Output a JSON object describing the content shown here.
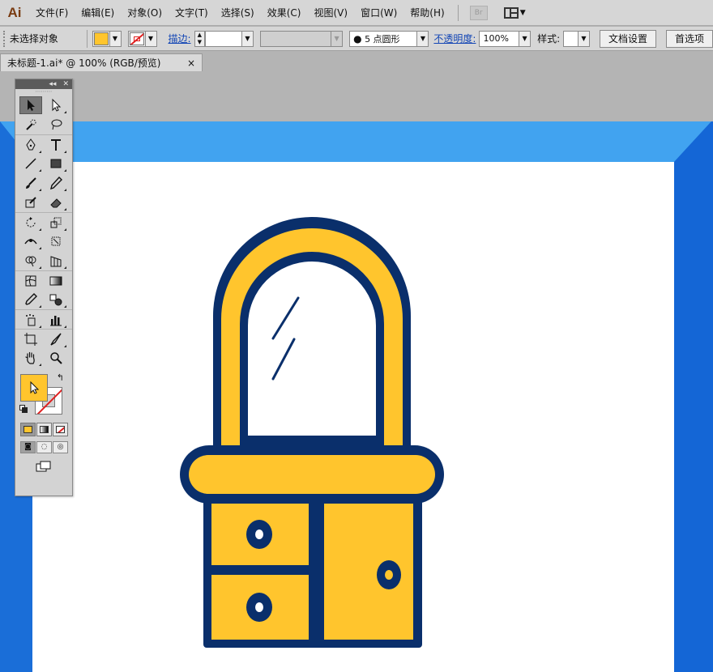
{
  "app": {
    "logo": "Ai"
  },
  "menubar": {
    "items": [
      "文件(F)",
      "编辑(E)",
      "对象(O)",
      "文字(T)",
      "选择(S)",
      "效果(C)",
      "视图(V)",
      "窗口(W)",
      "帮助(H)"
    ],
    "bridge_label": "Br"
  },
  "controlbar": {
    "selection_label": "未选择对象",
    "stroke_label": "描边:",
    "stroke_weight": "",
    "variable_width": "",
    "brush_label": "5 点圆形",
    "opacity_label": "不透明度:",
    "opacity_value": "100%",
    "style_label": "样式:",
    "doc_setup_button": "文档设置",
    "preferences_button": "首选项"
  },
  "tab": {
    "title": "未标题-1.ai* @ 100% (RGB/预览)",
    "close": "×"
  },
  "tools_panel": {
    "collapse": "◂◂",
    "close": "✕",
    "swap_symbol": "↰"
  },
  "colors": {
    "fill": "#ffc52d",
    "navy": "#0a2f6b",
    "canvas_blue": "#1a73d8",
    "canvas_blue_light": "#41a3f0",
    "artboard": "#ffffff",
    "accent_link": "#1245b5"
  }
}
